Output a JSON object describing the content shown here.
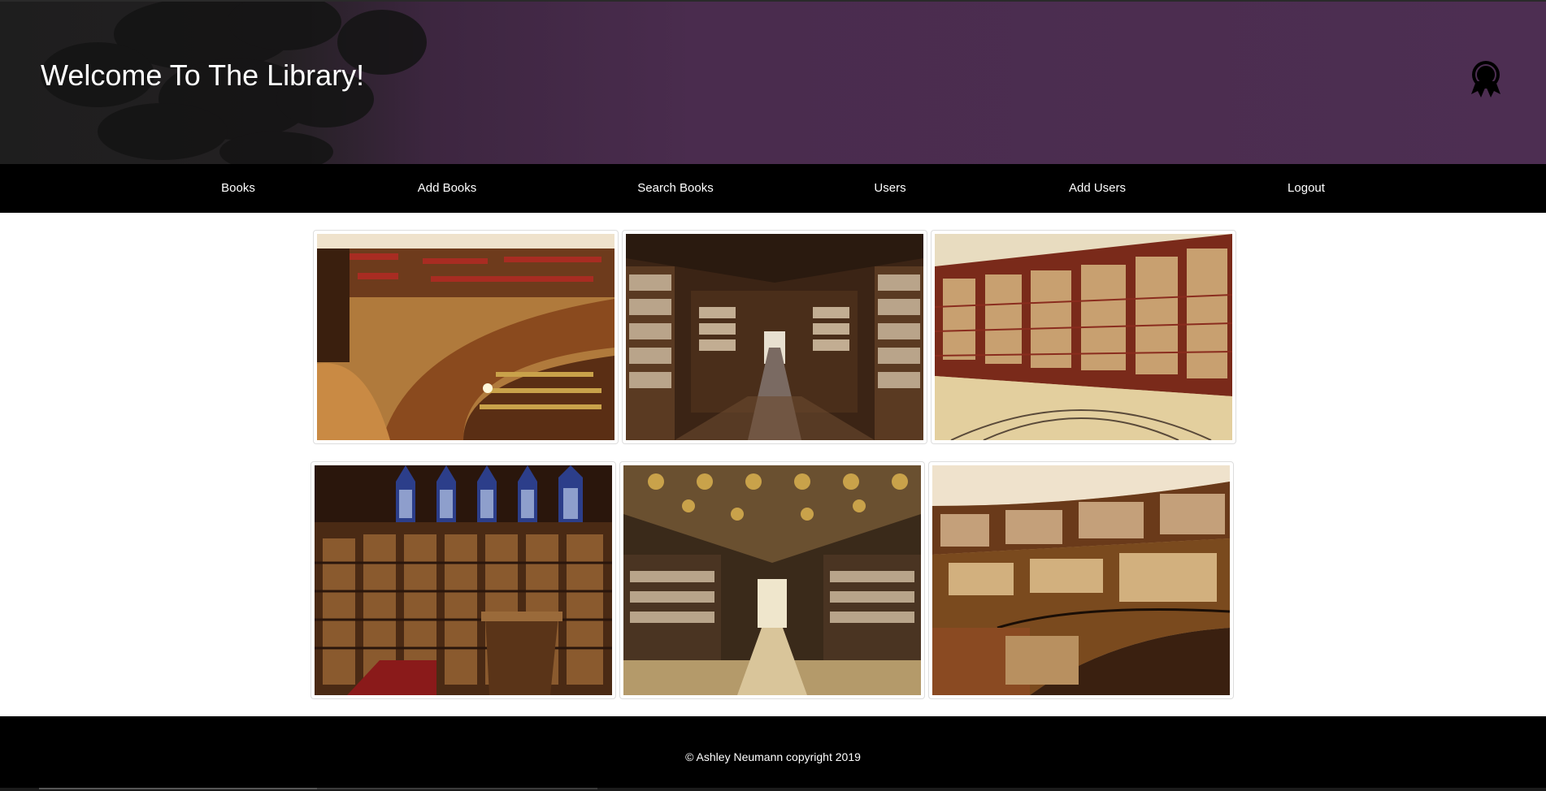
{
  "header": {
    "title": "Welcome To The Library!",
    "logo_icon": "quill-ribbon-icon"
  },
  "nav": {
    "items": [
      {
        "label": "Books"
      },
      {
        "label": "Add Books"
      },
      {
        "label": "Search Books"
      },
      {
        "label": "Users"
      },
      {
        "label": "Add Users"
      },
      {
        "label": "Logout"
      }
    ]
  },
  "gallery": {
    "images": [
      {
        "icon": "curved-library-shelves-image"
      },
      {
        "icon": "library-corridor-image"
      },
      {
        "icon": "rotunda-bookcases-image"
      },
      {
        "icon": "gothic-library-image"
      },
      {
        "icon": "ornate-ceiling-library-image"
      },
      {
        "icon": "circular-library-balcony-image"
      }
    ]
  },
  "footer": {
    "text": "© Ashley Neumann copyright 2019"
  },
  "colors": {
    "banner": "#4d2e52",
    "nav": "#000000",
    "footer": "#000000",
    "wood": "#7a4a1e"
  }
}
